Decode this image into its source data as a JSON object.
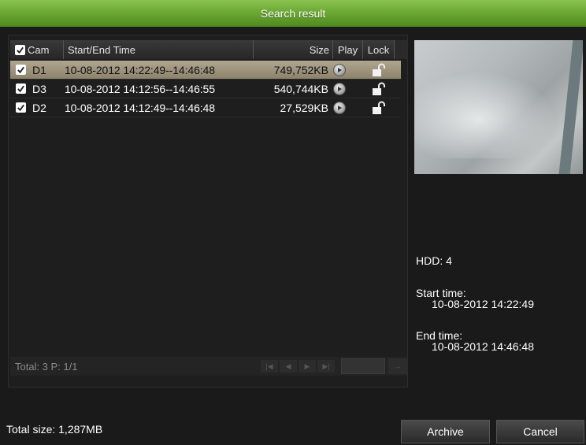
{
  "window": {
    "title": "Search result"
  },
  "table": {
    "headers": {
      "cam": "Cam",
      "time": "Start/End Time",
      "size": "Size",
      "play": "Play",
      "lock": "Lock"
    },
    "rows": [
      {
        "cam": "D1",
        "time": "10-08-2012 14:22:49--14:46:48",
        "size": "749,752KB",
        "selected": true
      },
      {
        "cam": "D3",
        "time": "10-08-2012 14:12:56--14:46:55",
        "size": "540,744KB",
        "selected": false
      },
      {
        "cam": "D2",
        "time": "10-08-2012 14:12:49--14:46:48",
        "size": "27,529KB",
        "selected": false
      }
    ],
    "footer": {
      "total": "Total: 3  P: 1/1"
    }
  },
  "details": {
    "hdd": "HDD: 4",
    "start_label": "Start time:",
    "start_value": "10-08-2012 14:22:49",
    "end_label": "End time:",
    "end_value": "10-08-2012 14:46:48"
  },
  "bottom": {
    "total_size": "Total size: 1,287MB",
    "archive_label": "Archive",
    "cancel_label": "Cancel"
  },
  "colors": {
    "title_bar": "#6aa632",
    "selected_row": "#a39981",
    "background": "#1a1a1a"
  },
  "icons": {
    "play": "play-icon",
    "lock": "unlock-icon",
    "checkbox": "checkbox-checked-icon"
  }
}
